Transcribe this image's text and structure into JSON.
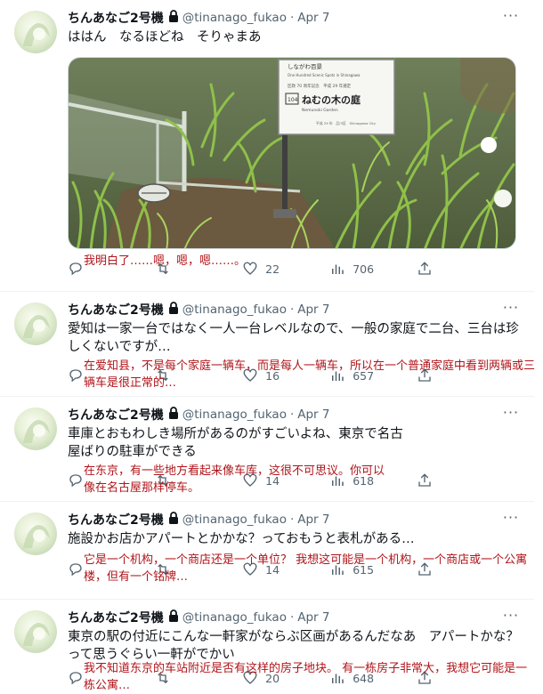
{
  "tweets": [
    {
      "name": "ちんあなご2号機",
      "handle": "@tinanago_fukao",
      "date": "Apr 7",
      "text": "ははん　なるほどね　そりゃまあ",
      "translation": "我明白了……嗯，嗯，嗯……。",
      "replies": "",
      "retweets": "",
      "likes": "22",
      "views": "706",
      "image": {
        "sign_line1": "しながわ百景",
        "sign_line2": "One Hundred Scenic Spots in Shinagawa",
        "sign_line3": "区政 70 周年記念　平成 29 年選定",
        "sign_number": "104",
        "sign_title": "ねむの木の庭",
        "sign_subtitle": "Nemunoki Garden",
        "sign_footer": "平成 29 年　品川区　Shinagawa City"
      }
    },
    {
      "name": "ちんあなご2号機",
      "handle": "@tinanago_fukao",
      "date": "Apr 7",
      "text": "愛知は一家一台ではなく一人一台レベルなので、一般の家庭で二台、三台は珍しくないですが…",
      "translation": "在爱知县，不是每个家庭一辆车，而是每人一辆车，所以在一个普通家庭中看到两辆或三辆车是很正常的…",
      "replies": "",
      "retweets": "",
      "likes": "16",
      "views": "657"
    },
    {
      "name": "ちんあなご2号機",
      "handle": "@tinanago_fukao",
      "date": "Apr 7",
      "text": "車庫とおもわしき場所があるのがすごいよね、東京で名古屋ばりの駐車ができる",
      "translation": "在东京，有一些地方看起来像车库，这很不可思议。你可以像在名古屋那样停车。",
      "replies": "",
      "retweets": "",
      "likes": "14",
      "views": "618"
    },
    {
      "name": "ちんあなご2号機",
      "handle": "@tinanago_fukao",
      "date": "Apr 7",
      "text": "施設かお店かアパートとかかな？っておもうと表札がある…",
      "translation": "它是一个机构，一个商店还是一个单位？ 我想这可能是一个机构，一个商店或一个公寓楼，但有一个铭牌…",
      "replies": "",
      "retweets": "",
      "likes": "14",
      "views": "615"
    },
    {
      "name": "ちんあなご2号機",
      "handle": "@tinanago_fukao",
      "date": "Apr 7",
      "text": "東京の駅の付近にこんな一軒家がならぶ区画があるんだなあ　アパートかな？って思うぐらい一軒がでかい",
      "translation": "我不知道东京的车站附近是否有这样的房子地块。 有一栋房子非常大，我想它可能是一栋公寓…",
      "replies": "",
      "retweets": "",
      "likes": "20",
      "views": "648"
    }
  ],
  "icons": {
    "more": "more-dots-icon",
    "lock": "lock-icon",
    "reply": "reply-icon",
    "retweet": "retweet-icon",
    "like": "heart-icon",
    "views": "views-bar-chart-icon",
    "share": "share-icon"
  },
  "colors": {
    "translation_text": "#b0141a",
    "secondary_text": "#536471",
    "primary_text": "#0f1419",
    "divider": "#eff3f4"
  }
}
